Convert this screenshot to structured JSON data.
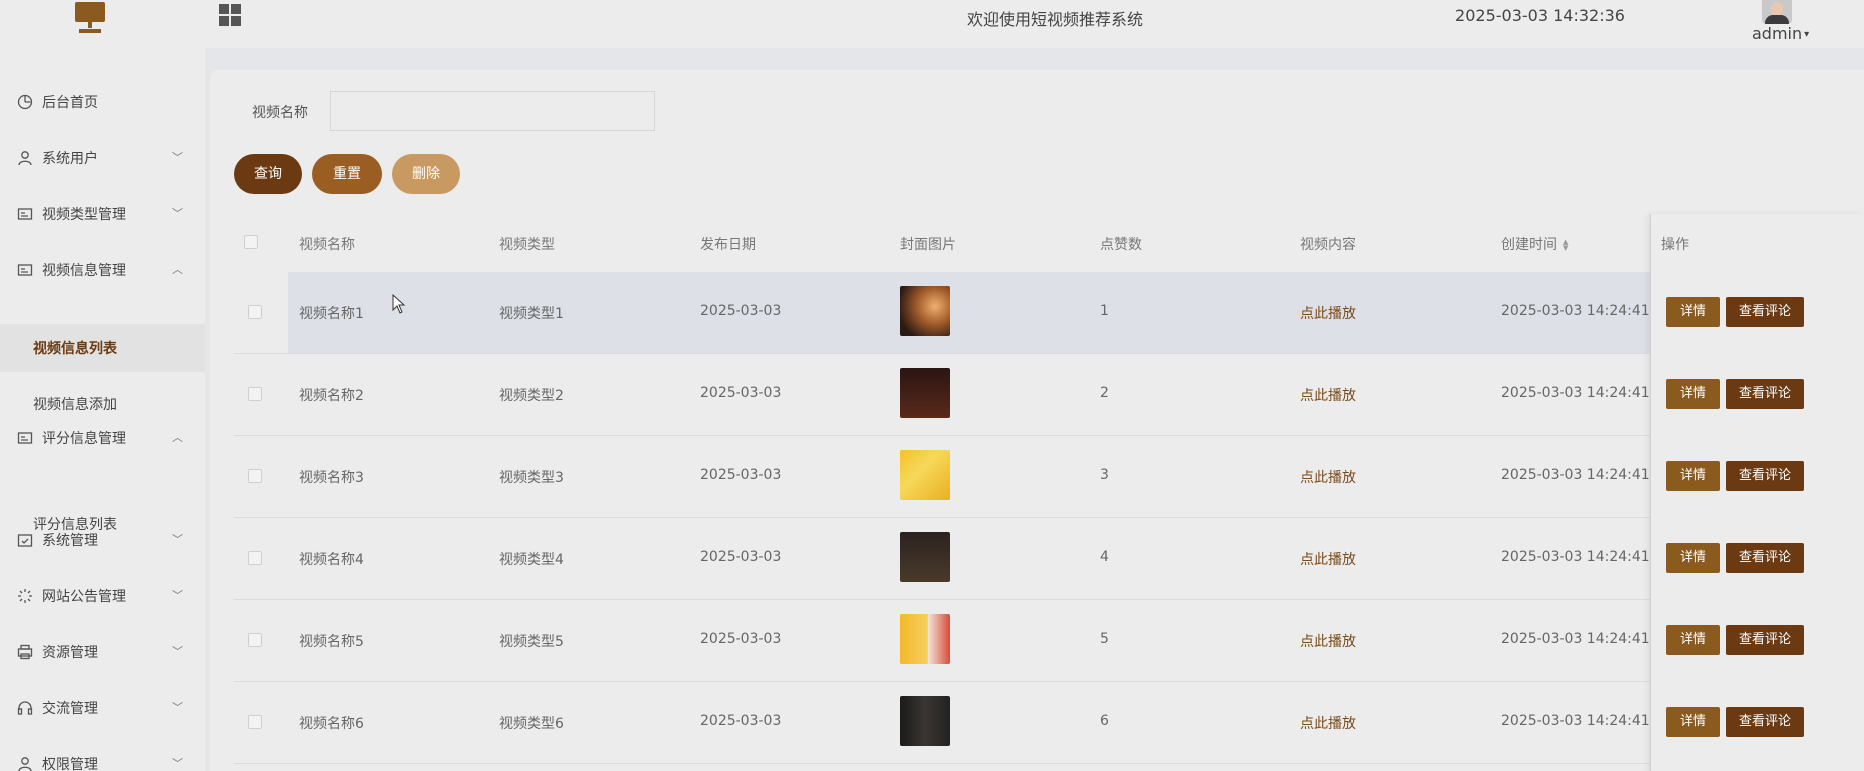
{
  "header": {
    "title": "欢迎使用短视频推荐系统",
    "datetime": "2025-03-03 14:32:36",
    "user": "admin"
  },
  "sidebar": {
    "items": [
      {
        "label": "后台首页",
        "icon": "dashboard-icon",
        "expanded": null
      },
      {
        "label": "系统用户",
        "icon": "user-icon",
        "expanded": false
      },
      {
        "label": "视频类型管理",
        "icon": "card-icon",
        "expanded": false
      },
      {
        "label": "视频信息管理",
        "icon": "card-icon",
        "expanded": true
      },
      {
        "label": "评分信息管理",
        "icon": "card-icon",
        "expanded": true
      },
      {
        "label": "系统管理",
        "icon": "calendar-check-icon",
        "expanded": false
      },
      {
        "label": "网站公告管理",
        "icon": "loading-icon",
        "expanded": false
      },
      {
        "label": "资源管理",
        "icon": "printer-icon",
        "expanded": false
      },
      {
        "label": "交流管理",
        "icon": "headset-icon",
        "expanded": false
      },
      {
        "label": "权限管理",
        "icon": "user-icon",
        "expanded": false
      }
    ],
    "sub_video": [
      "视频信息列表",
      "视频信息添加"
    ],
    "sub_rating": [
      "评分信息列表"
    ]
  },
  "search": {
    "label": "视频名称",
    "value": "",
    "placeholder": ""
  },
  "buttons": {
    "query": "查询",
    "reset": "重置",
    "delete": "删除"
  },
  "table": {
    "columns": [
      "视频名称",
      "视频类型",
      "发布日期",
      "封面图片",
      "点赞数",
      "视频内容",
      "创建时间",
      "操作"
    ],
    "rows": [
      {
        "name": "视频名称1",
        "type": "视频类型1",
        "date": "2025-03-03",
        "likes": "1",
        "content": "点此播放",
        "created": "2025-03-03 14:24:41"
      },
      {
        "name": "视频名称2",
        "type": "视频类型2",
        "date": "2025-03-03",
        "likes": "2",
        "content": "点此播放",
        "created": "2025-03-03 14:24:41"
      },
      {
        "name": "视频名称3",
        "type": "视频类型3",
        "date": "2025-03-03",
        "likes": "3",
        "content": "点此播放",
        "created": "2025-03-03 14:24:41"
      },
      {
        "name": "视频名称4",
        "type": "视频类型4",
        "date": "2025-03-03",
        "likes": "4",
        "content": "点此播放",
        "created": "2025-03-03 14:24:41"
      },
      {
        "name": "视频名称5",
        "type": "视频类型5",
        "date": "2025-03-03",
        "likes": "5",
        "content": "点此播放",
        "created": "2025-03-03 14:24:41"
      },
      {
        "name": "视频名称6",
        "type": "视频类型6",
        "date": "2025-03-03",
        "likes": "6",
        "content": "点此播放",
        "created": "2025-03-03 14:24:41"
      }
    ],
    "row_actions": {
      "detail": "详情",
      "comments": "查看评论"
    }
  },
  "colors": {
    "primary": "#6b3a12",
    "secondary": "#9b5e22",
    "light": "#c89a62",
    "detail_btn": "#8b5a1e"
  }
}
